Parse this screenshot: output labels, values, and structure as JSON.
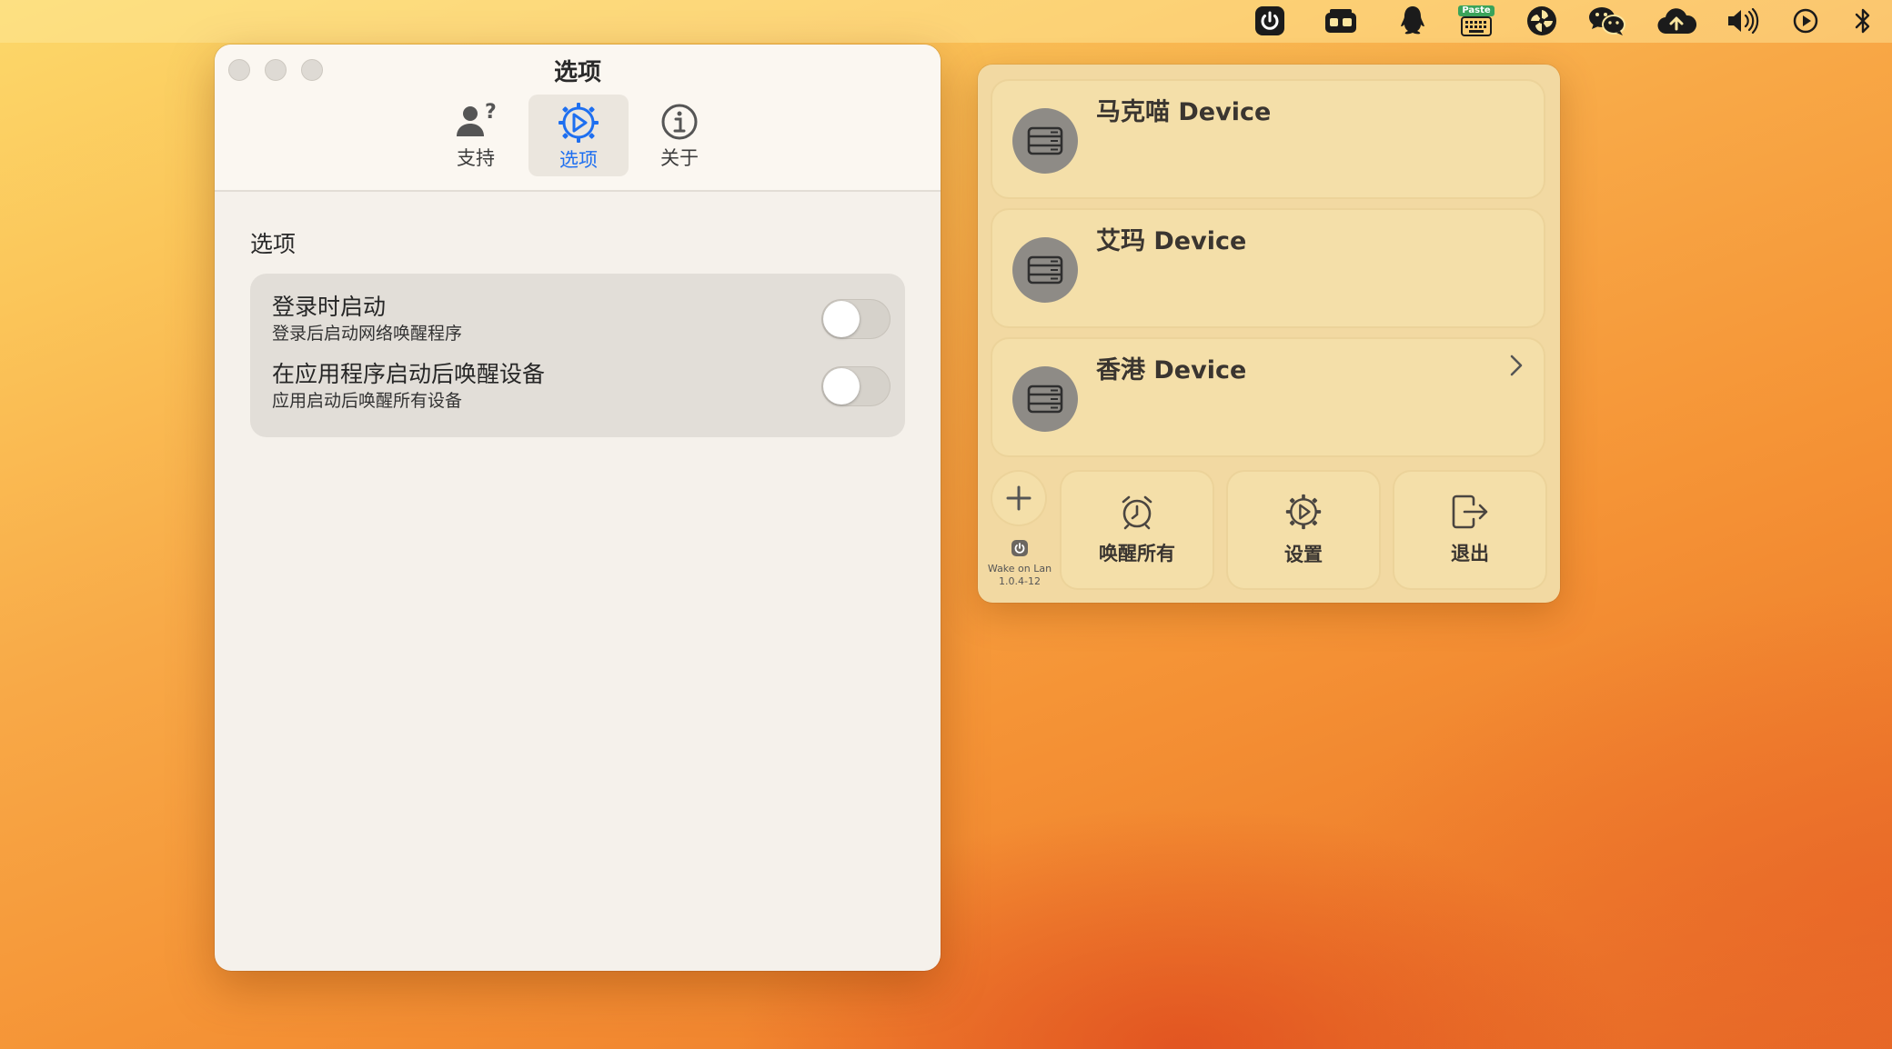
{
  "menubar": {
    "icons": [
      "power-icon",
      "radio-icon",
      "qq-penguin-icon",
      "paste-icon",
      "pinwheel-icon",
      "wechat-icon",
      "cloud-upload-icon",
      "volume-icon",
      "play-circle-icon",
      "bluetooth-icon"
    ],
    "paste_badge": "Paste"
  },
  "window": {
    "title": "选项",
    "tabs": [
      {
        "label": "支持",
        "icon": "person-question-icon"
      },
      {
        "label": "选项",
        "icon": "gear-play-icon",
        "active": true
      },
      {
        "label": "关于",
        "icon": "info-icon"
      }
    ],
    "section_heading": "选项",
    "options": [
      {
        "title": "登录时启动",
        "subtitle": "登录后启动网络唤醒程序",
        "enabled": false
      },
      {
        "title": "在应用程序启动后唤醒设备",
        "subtitle": "应用启动后唤醒所有设备",
        "enabled": false
      }
    ]
  },
  "popover": {
    "devices": [
      {
        "name": "马克喵 Device",
        "icon": "server-icon"
      },
      {
        "name": "艾玛 Device",
        "icon": "server-icon"
      },
      {
        "name": "香港 Device",
        "icon": "server-icon"
      }
    ],
    "app_name": "Wake on Lan",
    "app_version": "1.0.4-12",
    "actions": [
      {
        "label": "唤醒所有",
        "icon": "alarm-clock-icon"
      },
      {
        "label": "设置",
        "icon": "gear-icon"
      },
      {
        "label": "退出",
        "icon": "exit-icon"
      }
    ],
    "colors": {
      "accent": "#1e6ff0"
    }
  }
}
